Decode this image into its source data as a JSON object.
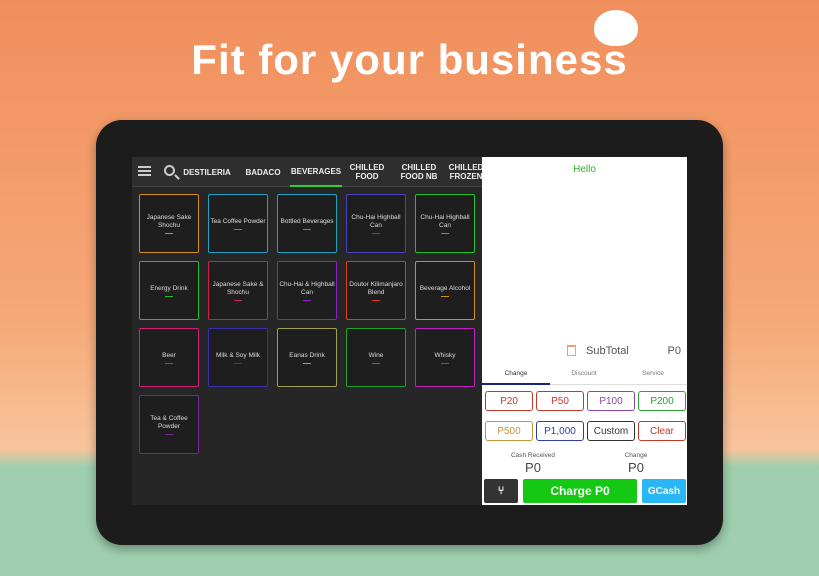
{
  "headline": "Fit for your business",
  "colors": {
    "accent": "#2ed22e",
    "charge": "#14c814",
    "gcash": "#29b6f6"
  },
  "nav": {
    "menu_icon": "hamburger-icon",
    "search_icon": "search-icon",
    "tabs": [
      "DESTILERIA",
      "BADACO",
      "BEVERAGES",
      "CHILLED FOOD",
      "CHILLED FOOD NB",
      "CHILLED FROZEN"
    ],
    "active": "BEVERAGES"
  },
  "tiles": [
    {
      "label": "Japanese Sake Shochu",
      "color": "#d98a1f"
    },
    {
      "label": "Tea  Coffee Powder",
      "color": "#1fa0c0"
    },
    {
      "label": "Bottled Beverages",
      "color": "#1fa0c0"
    },
    {
      "label": "Chu-Hai Highball Can",
      "color": "#4a3fc0"
    },
    {
      "label": "Chu-Hai Highball Can",
      "color": "#22c02a"
    },
    {
      "label": "Energy Drink",
      "color": "#22c02a"
    },
    {
      "label": "Japanese Sake & Shochu",
      "color": "#d02050"
    },
    {
      "label": "Chu-Hai & Highball Can",
      "color": "#9020c0"
    },
    {
      "label": "Doutor Kilimanjaro Blend",
      "color": "#e03a1a"
    },
    {
      "label": "Beverage Alcohol",
      "color": "#d98a1f"
    },
    {
      "label": "Beer",
      "color": "#d0207a"
    },
    {
      "label": "Milk & Soy Milk",
      "color": "#3a30b0"
    },
    {
      "label": "Eanas Drink",
      "color": "#a0a050"
    },
    {
      "label": "Wine",
      "color": "#20a030"
    },
    {
      "label": "Whisky",
      "color": "#c020c0"
    },
    {
      "label": "Tea & Coffee Powder",
      "color": "#8020a0"
    }
  ],
  "panel": {
    "greeting": "Hello",
    "subtotal_label": "SubTotal",
    "subtotal": "P0",
    "tabs": [
      "Change",
      "Discount",
      "Service"
    ],
    "amounts": [
      {
        "label": "P20",
        "color": "#c0392b"
      },
      {
        "label": "P50",
        "color": "#c0392b"
      },
      {
        "label": "P100",
        "color": "#8e44ad"
      },
      {
        "label": "P200",
        "color": "#27a035"
      },
      {
        "label": "P500",
        "color": "#c8913a"
      },
      {
        "label": "P1,000",
        "color": "#2c3e9f"
      },
      {
        "label": "Custom",
        "color": "#333333"
      },
      {
        "label": "Clear",
        "color": "#c0392b"
      }
    ],
    "cash_received_label": "Cash Received",
    "cash_received": "P0",
    "change_label": "Change",
    "change": "P0",
    "charge": "Charge P0",
    "gcash": "GCash"
  }
}
